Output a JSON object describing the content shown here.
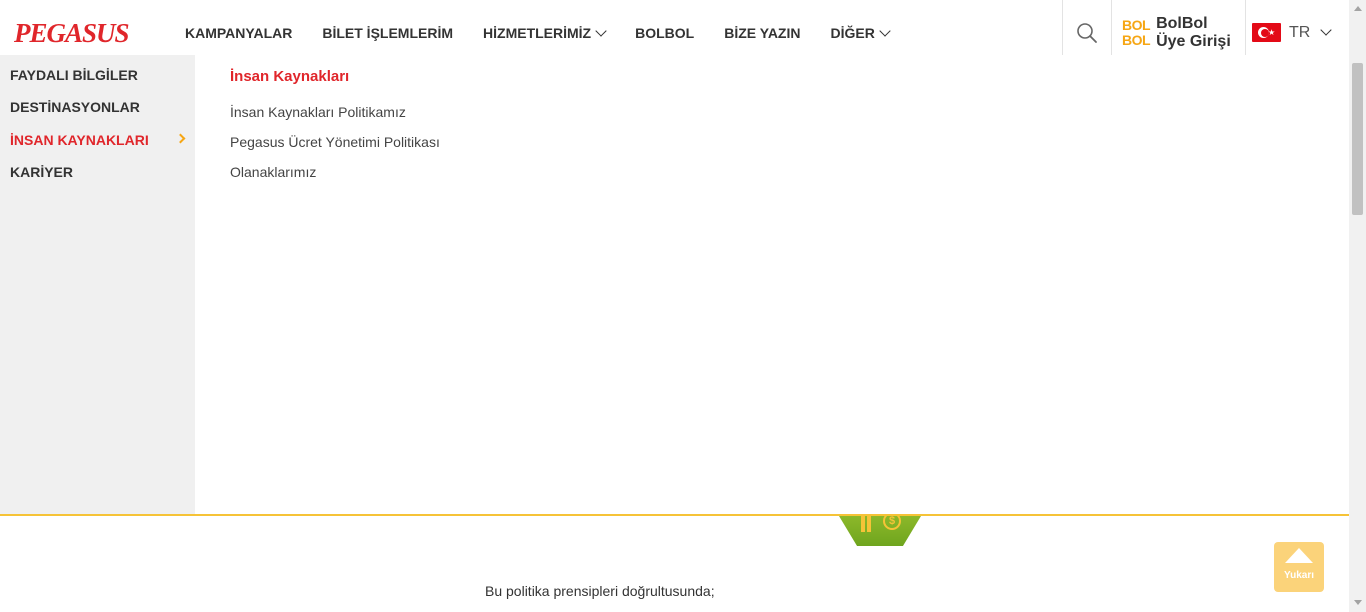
{
  "header": {
    "logo_text": "PEGASUS",
    "nav": [
      {
        "label": "KAMPANYALAR",
        "has_dropdown": false
      },
      {
        "label": "BİLET İŞLEMLERİM",
        "has_dropdown": false
      },
      {
        "label": "HİZMETLERİMİZ",
        "has_dropdown": true
      },
      {
        "label": "BOLBOL",
        "has_dropdown": false
      },
      {
        "label": "BİZE YAZIN",
        "has_dropdown": false
      },
      {
        "label": "DİĞER",
        "has_dropdown": true
      }
    ],
    "search_icon": "search-icon",
    "bolbol_logo": [
      "BOL",
      "BOL"
    ],
    "bolbol_login": [
      "BolBol",
      "Üye Girişi"
    ],
    "language": {
      "code": "TR",
      "flag": "turkey-flag-icon"
    }
  },
  "mega_menu": {
    "sidebar": [
      {
        "label": "FAYDALI BİLGİLER",
        "active": false
      },
      {
        "label": "DESTİNASYONLAR",
        "active": false
      },
      {
        "label": "İNSAN KAYNAKLARI",
        "active": true
      },
      {
        "label": "KARİYER",
        "active": false
      }
    ],
    "submenu_title": "İnsan Kaynakları",
    "submenu_links": [
      "İnsan Kaynakları Politikamız",
      "Pegasus Ücret Yönetimi Politikası",
      "Olanaklarımız"
    ]
  },
  "page": {
    "body_text": "Bu politika prensipleri doğrultusunda;",
    "back_to_top_label": "Yukarı"
  },
  "colors": {
    "brand_red": "#e0262b",
    "accent_yellow": "#f6a614",
    "green": "#7fb126"
  }
}
